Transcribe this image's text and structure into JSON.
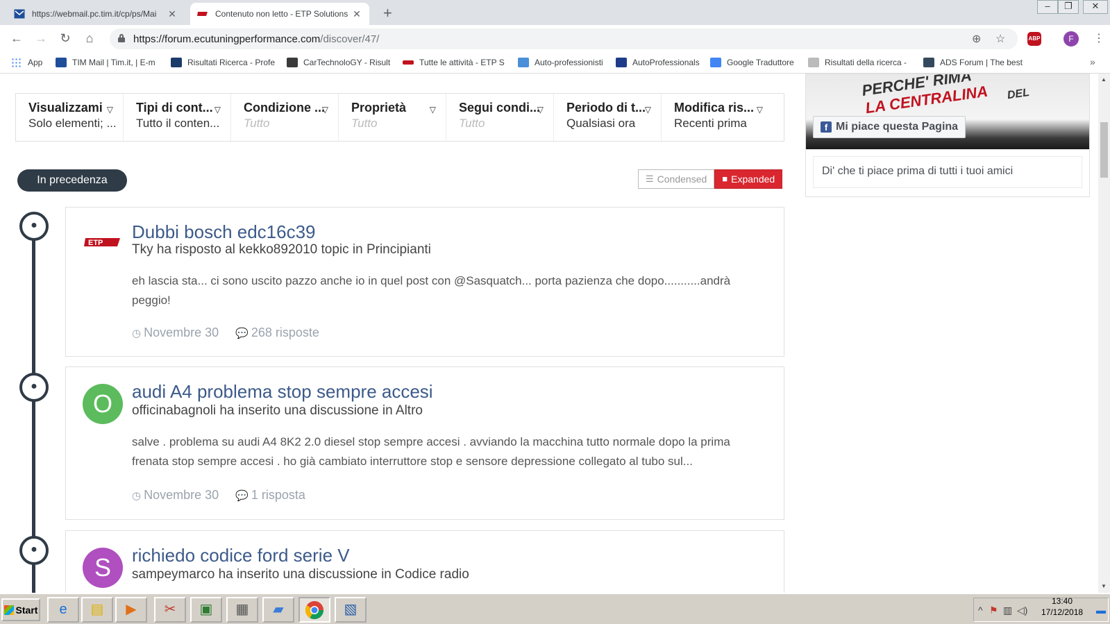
{
  "browser": {
    "tabs": [
      {
        "title": "https://webmail.pc.tim.it/cp/ps/Mai",
        "icon": "mail-icon"
      },
      {
        "title": "Contenuto non letto - ETP Solutions",
        "icon": "etp-logo-icon"
      }
    ],
    "url_main": "https://forum.ecutuningperformance.com",
    "url_path": "/discover/47/",
    "profile_initial": "F",
    "abp_label": "ABP"
  },
  "bookmarks": [
    {
      "label": "App",
      "icon": "apps-grid-icon",
      "color": "#4285f4"
    },
    {
      "label": "TIM Mail | Tim.it, | E-m",
      "icon": "mail-icon",
      "color": "#1f4e9a"
    },
    {
      "label": "Risultati Ricerca - Profe",
      "icon": "bookmark-icon",
      "color": "#1b3c6b"
    },
    {
      "label": "CarTechnoloGY - Risult",
      "icon": "car-icon",
      "color": "#3a3a3a"
    },
    {
      "label": "Tutte le attività - ETP S",
      "icon": "etp-logo-icon",
      "color": "#c1121f"
    },
    {
      "label": "Auto-professionisti",
      "icon": "car-icon",
      "color": "#4a90d9"
    },
    {
      "label": "AutoProfessionals",
      "icon": "bookmark-icon",
      "color": "#1f3c8a"
    },
    {
      "label": "Google Traduttore",
      "icon": "translate-icon",
      "color": "#4285f4"
    },
    {
      "label": "Risultati della ricerca - ",
      "icon": "bookmark-icon",
      "color": "#999999"
    },
    {
      "label": "ADS Forum | The best",
      "icon": "car-icon",
      "color": "#34495e"
    }
  ],
  "filters": [
    {
      "label": "Visualizzami",
      "value": "Solo elementi; ...",
      "muted": false
    },
    {
      "label": "Tipi di cont...",
      "value": "Tutto il conten...",
      "muted": false
    },
    {
      "label": "Condizione ...",
      "value": "Tutto",
      "muted": true
    },
    {
      "label": "Proprietà",
      "value": "Tutto",
      "muted": true
    },
    {
      "label": "Segui condi...",
      "value": "Tutto",
      "muted": true
    },
    {
      "label": "Periodo di t...",
      "value": "Qualsiasi ora",
      "muted": false
    },
    {
      "label": "Modifica ris...",
      "value": "Recenti prima",
      "muted": false
    }
  ],
  "timeline": {
    "pill": "In precedenza",
    "view_condensed": "Condensed",
    "view_expanded": "Expanded"
  },
  "posts": [
    {
      "title": "Dubbi bosch edc16c39",
      "meta": "Tky ha risposto al kekko892010 topic in Principianti",
      "body": "eh lascia sta... ci sono uscito pazzo anche io in quel post con @Sasquatch... porta pazienza che dopo...........andrà peggio!",
      "date": "Novembre 30",
      "replies": "268 risposte",
      "avatar": "",
      "avatar_color": ""
    },
    {
      "title": "audi A4 problema stop sempre accesi",
      "meta": "officinabagnoli ha inserito una discussione in Altro",
      "body": "salve . problema su audi A4 8K2 2.0 diesel stop sempre accesi . avviando la macchina tutto normale dopo la prima frenata stop sempre accesi . ho già cambiato interruttore stop e sensore depressione collegato al tubo sul...",
      "date": "Novembre 30",
      "replies": "1 risposta",
      "avatar": "O",
      "avatar_color": "#5cbb5c"
    },
    {
      "title": "richiedo codice ford serie V",
      "meta": "sampeymarco ha inserito una discussione in Codice radio",
      "body": "",
      "date": "",
      "replies": "",
      "avatar": "S",
      "avatar_color": "#b04fc0"
    }
  ],
  "sidebar": {
    "fb_image_line1": "PERCHE' RIMA",
    "fb_image_line2": "LA CENTRALINA",
    "fb_image_line3": "DEL",
    "fb_like": "Mi piace questa Pagina",
    "fb_friends": "Di' che ti piace prima di tutti i tuoi amici"
  },
  "taskbar": {
    "start": "Start",
    "time": "13:40",
    "date": "17/12/2018"
  }
}
